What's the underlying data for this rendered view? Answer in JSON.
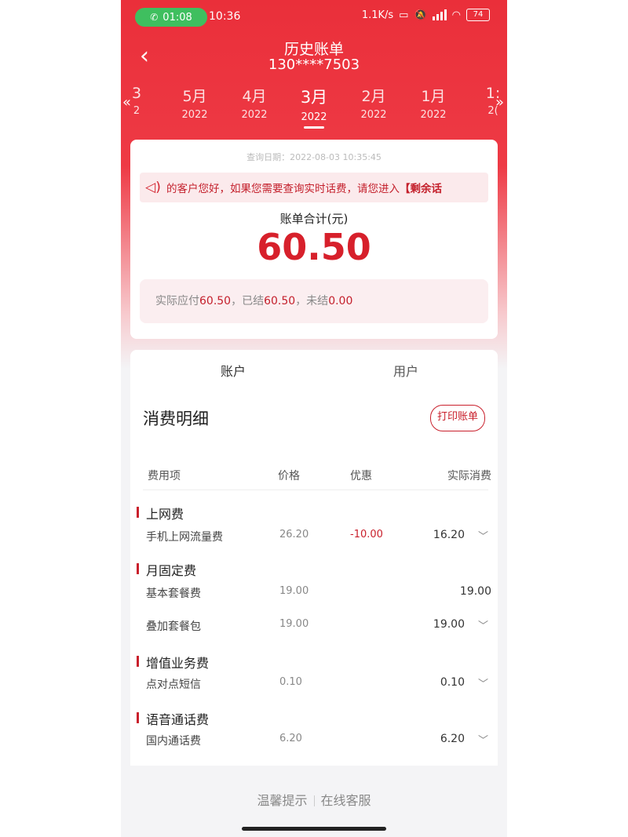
{
  "status_bar": {
    "call_time": "01:08",
    "clock": "10:36",
    "net_speed": "1.1K/s",
    "battery": "74"
  },
  "header": {
    "title": "历史账单",
    "phone": "130****7503"
  },
  "months": {
    "items": [
      {
        "month": "3",
        "year": "2"
      },
      {
        "month": "5月",
        "year": "2022"
      },
      {
        "month": "4月",
        "year": "2022"
      },
      {
        "month": "3月",
        "year": "2022"
      },
      {
        "month": "2月",
        "year": "2022"
      },
      {
        "month": "1月",
        "year": "2022"
      },
      {
        "month": "1:",
        "year": "2("
      }
    ],
    "active_index": 3
  },
  "summary": {
    "query_date": "查询日期：2022-08-03 10:35:45",
    "notice_text": "的客户您好，如果您需要查询实时话费，请您进入",
    "notice_bold": "【剩余话",
    "total_label": "账单合计(元)",
    "total": "60.50",
    "paid_l1": "实际应付",
    "paid_v1": "60.50",
    "paid_l2": "，已结",
    "paid_v2": "60.50",
    "paid_l3": "，未结",
    "paid_v3": "0.00"
  },
  "tabs": {
    "account": "账户",
    "user": "用户"
  },
  "detail": {
    "title": "消费明细",
    "print_label": "打印账单",
    "columns": {
      "item": "费用项",
      "price": "价格",
      "discount": "优惠",
      "actual": "实际消费"
    },
    "groups": [
      {
        "category": "上网费",
        "rows": [
          {
            "name": "手机上网流量费",
            "price": "26.20",
            "discount": "-10.00",
            "actual": "16.20",
            "expandable": true
          }
        ]
      },
      {
        "category": "月固定费",
        "rows": [
          {
            "name": "基本套餐费",
            "price": "19.00",
            "discount": "",
            "actual": "19.00",
            "expandable": false
          },
          {
            "name": "叠加套餐包",
            "price": "19.00",
            "discount": "",
            "actual": "19.00",
            "expandable": true
          }
        ]
      },
      {
        "category": "增值业务费",
        "rows": [
          {
            "name": "点对点短信",
            "price": "0.10",
            "discount": "",
            "actual": "0.10",
            "expandable": true
          }
        ]
      },
      {
        "category": "语音通话费",
        "rows": [
          {
            "name": "国内通话费",
            "price": "6.20",
            "discount": "",
            "actual": "6.20",
            "expandable": true
          }
        ]
      }
    ]
  },
  "footer": {
    "tips": "温馨提示",
    "service": "在线客服"
  },
  "colors": {
    "brand_red": "#ea2f3a",
    "accent_red": "#c9202c"
  }
}
